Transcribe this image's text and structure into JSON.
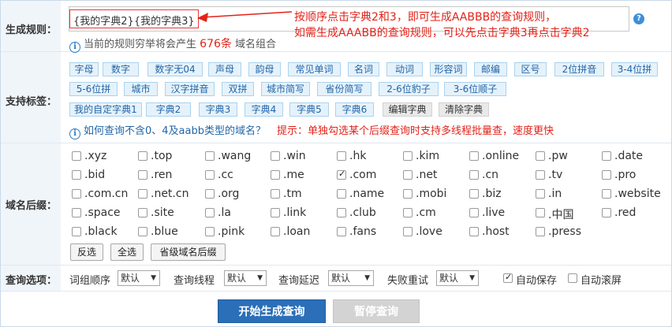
{
  "labels": {
    "rule": "生成规则：",
    "tags": "支持标签：",
    "suffix": "域名后缀：",
    "options": "查询选项："
  },
  "rule": {
    "input_value": "{我的字典2}{我的字典3}",
    "note_line1": "按顺序点击字典2和3，即可生成AABBB的查询规则，",
    "note_line2": "如需生成AAABB的查询规则，可以先点击字典3再点击字典2",
    "help_icon": "?",
    "info_prefix": "当前的规则穷举将会产生",
    "info_count": "676条",
    "info_suffix": "域名组合"
  },
  "tags": [
    [
      "字母",
      "数字",
      "数字无04",
      "声母",
      "韵母",
      "常见单词",
      "名词",
      "动词",
      "形容词",
      "邮编",
      "区号",
      "2位拼音",
      "3-4位拼"
    ],
    [
      "5-6位拼",
      "城市",
      "汉字拼音",
      "双拼",
      "城市简写",
      "省份简写",
      "2-6位豹子",
      "3-6位顺子"
    ],
    [
      "我的自定字典1",
      "字典2",
      "字典3",
      "字典4",
      "字典5",
      "字典6",
      "编辑字典",
      "清除字典"
    ]
  ],
  "tip": {
    "question": "如何查询不含0、4及aabb类型的域名？",
    "hint": "提示：单独勾选某个后缀查询时支持多线程批量查，速度更快"
  },
  "suffixes": [
    [
      ".xyz",
      ".top",
      ".wang",
      ".win",
      ".hk",
      ".kim",
      ".online",
      ".pw",
      ".date"
    ],
    [
      ".bid",
      ".ren",
      ".cc",
      ".me",
      ".com",
      ".net",
      ".cn",
      ".tv",
      ".pro"
    ],
    [
      ".com.cn",
      ".net.cn",
      ".org",
      ".tm",
      ".name",
      ".mobi",
      ".biz",
      ".in",
      ".website"
    ],
    [
      ".space",
      ".site",
      ".la",
      ".link",
      ".club",
      ".cm",
      ".live",
      ".中国",
      ".red"
    ],
    [
      ".black",
      ".blue",
      ".pink",
      ".loan",
      ".fans",
      ".love",
      ".host",
      ".press"
    ]
  ],
  "checked_suffix": ".com",
  "suffix_buttons": {
    "invert": "反选",
    "select_all": "全选",
    "province": "省级域名后缀"
  },
  "options": {
    "order_label": "词组顺序",
    "order_value": "默认",
    "threads_label": "查询线程",
    "threads_value": "默认",
    "delay_label": "查询延迟",
    "delay_value": "默认",
    "retry_label": "失败重试",
    "retry_value": "默认",
    "autosave_label": "自动保存",
    "autosave_checked": true,
    "autoscroll_label": "自动滚屏",
    "autoscroll_checked": false
  },
  "actions": {
    "start": "开始生成查询",
    "pause": "暂停查询"
  },
  "colors": {
    "accent": "#2a6fb8",
    "tag_bg": "#e5f2fb",
    "note_red": "#e2231a"
  }
}
